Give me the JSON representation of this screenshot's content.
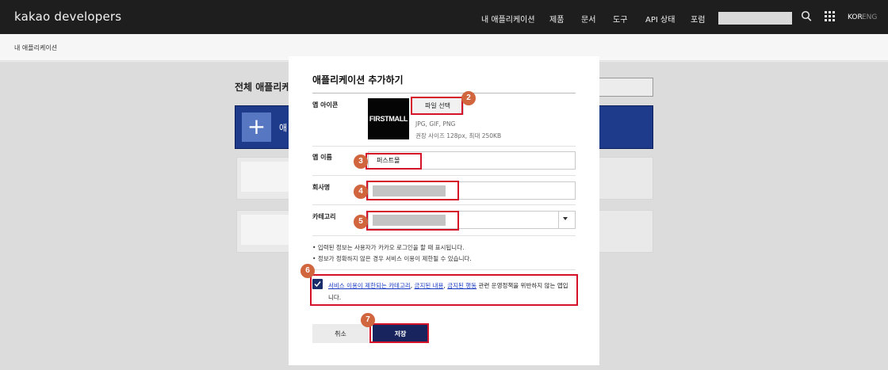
{
  "header": {
    "logo": "kakao developers",
    "nav": [
      "내 애플리케이션",
      "제품",
      "문서",
      "도구",
      "API 상태",
      "포럼"
    ],
    "lang_kor": "KOR",
    "lang_eng": "ENG",
    "icons": [
      "search-icon",
      "grid-menu-icon"
    ]
  },
  "breadcrumb": "내 애플리케이션",
  "background": {
    "title": "전체 애플리케이",
    "add_label": "애"
  },
  "modal": {
    "title": "애플리케이션 추가하기",
    "icon_label": "앱 아이콘",
    "icon_preview_text": "FIRSTMALL",
    "file_button": "파일 선택",
    "icon_hint1": "JPG, GIF, PNG",
    "icon_hint2": "권장 사이즈 128px, 최대 250KB",
    "name_label": "앱 이름",
    "name_value": "퍼스트몰",
    "company_label": "회사명",
    "category_label": "카테고리",
    "note1": "입력된 정보는 사용자가 카카오 로그인을 할 때 표시됩니다.",
    "note2": "정보가 정확하지 않은 경우 서비스 이용이 제한될 수 있습니다.",
    "agree_link1": "서비스 이용이 제한되는 카테고리",
    "agree_sep1": ", ",
    "agree_link2": "금지된 내용",
    "agree_sep2": ", ",
    "agree_link3": "금지된 행동",
    "agree_tail": " 관련 운영정책을 위반하지 않는 앱입니다.",
    "cancel": "취소",
    "save": "저장"
  },
  "annotations": [
    "2",
    "3",
    "4",
    "5",
    "6",
    "7"
  ],
  "colors": {
    "topbar": "#1e1e1e",
    "accent_navy": "#17245e",
    "annotation_red": "#d4122a",
    "badge": "#d0653e",
    "link": "#1a3cc4"
  }
}
